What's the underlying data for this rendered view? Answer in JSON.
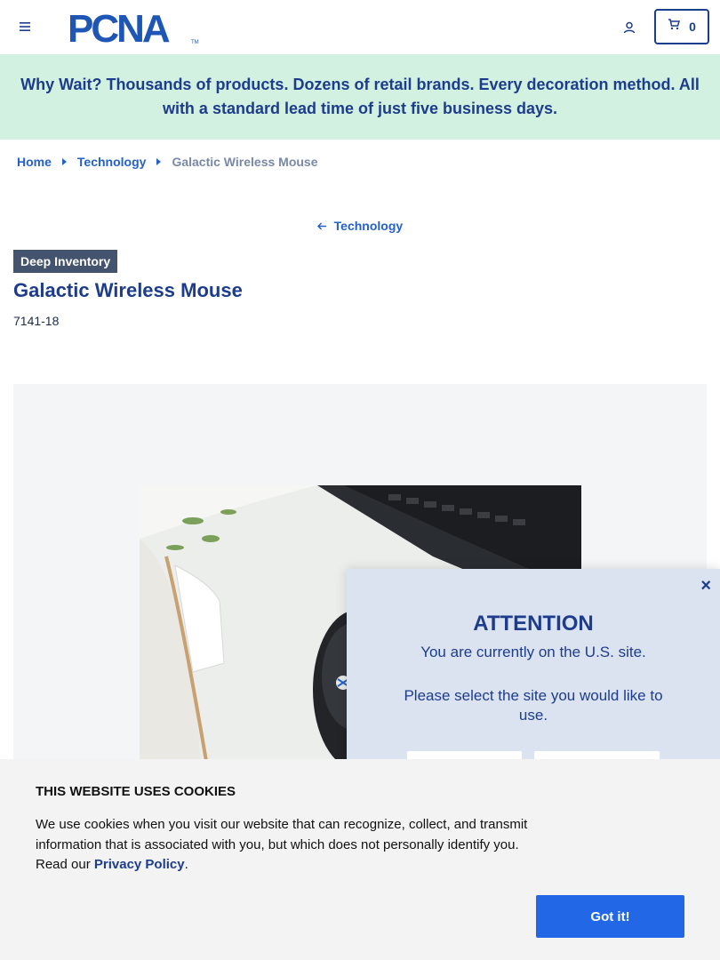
{
  "header": {
    "logo_text": "PCNA",
    "cart_count": "0"
  },
  "promo": {
    "text": "Why Wait? Thousands of products. Dozens of retail brands. Every decoration method. All with a standard lead time of just five business days."
  },
  "breadcrumb": {
    "items": [
      "Home",
      "Technology"
    ],
    "current": "Galactic Wireless Mouse"
  },
  "back_link": "Technology",
  "product": {
    "badge": "Deep Inventory",
    "title": "Galactic Wireless Mouse",
    "sku": "7141-18"
  },
  "modal": {
    "close": "×",
    "title": "ATTENTION",
    "line1": "You are currently on the U.S. site.",
    "line2": "Please select the site you would like to use."
  },
  "cookie": {
    "title": "THIS WEBSITE USES COOKIES",
    "text": "We use cookies when you visit our website that can recognize, collect, and transmit information that is associated with you, but which does not personally identify you. Read our ",
    "link": "Privacy Policy",
    "end": ".",
    "button": "Got it!"
  },
  "colors": {
    "brand": "#1d3c8c",
    "link": "#2461c9",
    "promo_bg": "#d3f1e1",
    "cookie_button": "#2268e6"
  }
}
